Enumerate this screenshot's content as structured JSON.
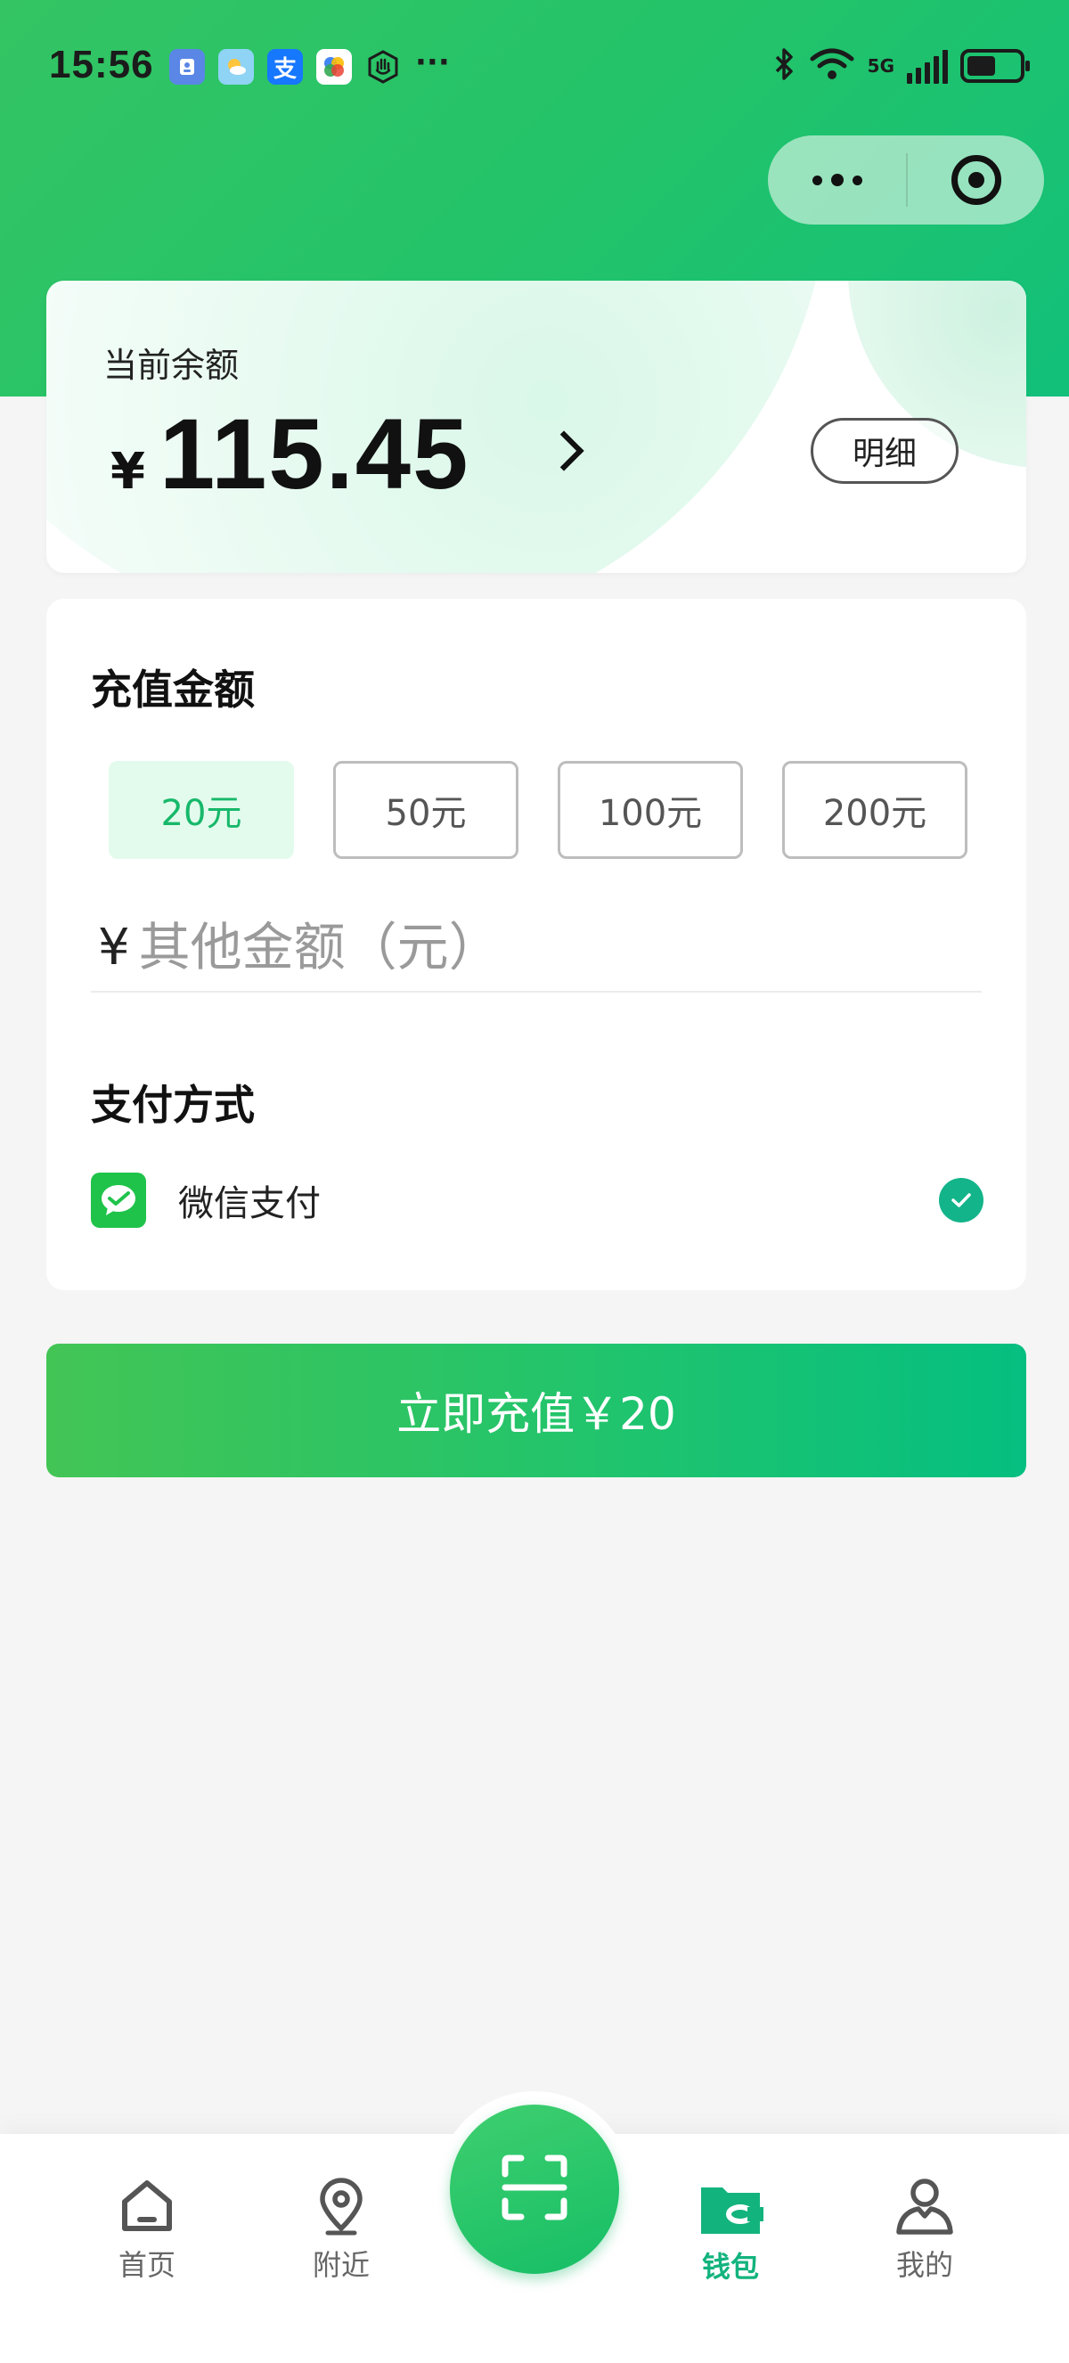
{
  "status_bar": {
    "time": "15:56",
    "more": "···",
    "network": "5G",
    "battery_level": 0.55,
    "app_icons": [
      "contacts-app-icon",
      "weather-app-icon",
      "alipay-app-icon",
      "photos-app-icon",
      "gesture-app-icon"
    ],
    "alipay_glyph": "支"
  },
  "balance": {
    "label": "当前余额",
    "currency": "¥",
    "amount": "115.45",
    "detail_label": "明细"
  },
  "recharge": {
    "title": "充值金额",
    "options": [
      "20元",
      "50元",
      "100元",
      "200元"
    ],
    "selected_index": 0,
    "currency": "¥",
    "other_placeholder": "其他金额（元）"
  },
  "payment": {
    "title": "支付方式",
    "method": "微信支付",
    "selected": true
  },
  "action": {
    "label": "立即充值￥20"
  },
  "tabs": [
    {
      "label": "首页",
      "icon": "home-icon",
      "active": false
    },
    {
      "label": "附近",
      "icon": "location-pin-icon",
      "active": false
    },
    {
      "label": "钱包",
      "icon": "wallet-icon",
      "active": true
    },
    {
      "label": "我的",
      "icon": "user-icon",
      "active": false
    }
  ],
  "colors": {
    "brand_green": "#22c36a",
    "accent_teal": "#13b37e",
    "selected_bg": "#e3fbec",
    "wechat_green": "#1fc34a"
  }
}
